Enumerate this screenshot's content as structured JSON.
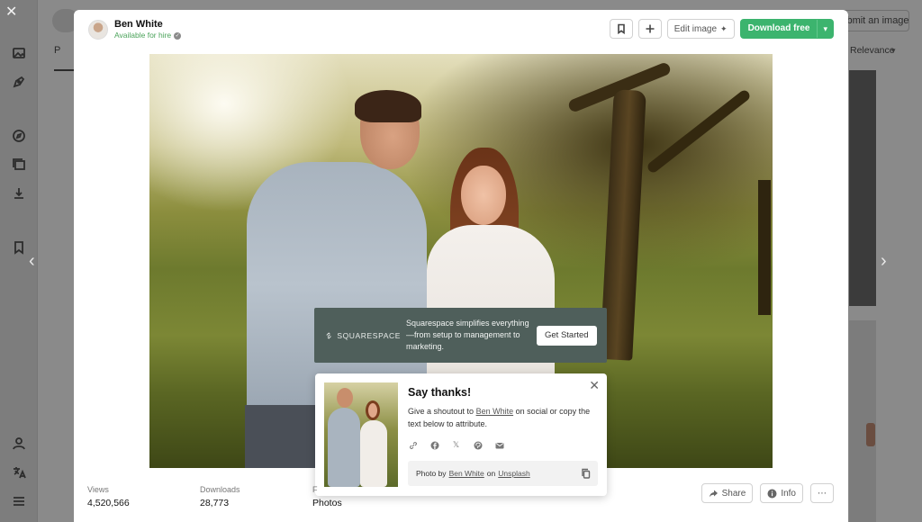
{
  "background": {
    "submit_label": "Submit an image",
    "sort_label": "Relevance",
    "tab_fragment": "P"
  },
  "sidebar_icons": [
    "image-icon",
    "pen-icon",
    "compass-icon",
    "collection-icon",
    "download-icon",
    "bookmark-icon",
    "user-icon",
    "translate-icon",
    "menu-icon"
  ],
  "modal": {
    "author": {
      "name": "Ben White",
      "status": "Available for hire"
    },
    "actions": {
      "edit_label": "Edit image",
      "download_label": "Download free"
    },
    "ad": {
      "brand": "SQUARESPACE",
      "text": "Squarespace simplifies everything—from setup to management to marketing.",
      "cta": "Get Started"
    },
    "thanks": {
      "title": "Say thanks!",
      "desc_before": "Give a shoutout to",
      "author_link": "Ben White",
      "desc_after": "on social or copy the text below to attribute.",
      "share_icons": [
        "link-icon",
        "facebook-icon",
        "x-icon",
        "pinterest-icon",
        "email-icon"
      ],
      "attr_prefix": "Photo by",
      "attr_author": "Ben White",
      "attr_on": "on",
      "attr_site": "Unsplash"
    },
    "stats": [
      {
        "label": "Views",
        "value": "4,520,566"
      },
      {
        "label": "Downloads",
        "value": "28,773"
      },
      {
        "label": "F",
        "value": "Photos"
      }
    ],
    "bottom_actions": {
      "share_label": "Share",
      "info_label": "Info",
      "more_label": "⋯"
    }
  },
  "colors": {
    "download_green": "#3cb46e",
    "ad_bg": "#4f5f5b",
    "available_green": "#4aa35a"
  }
}
